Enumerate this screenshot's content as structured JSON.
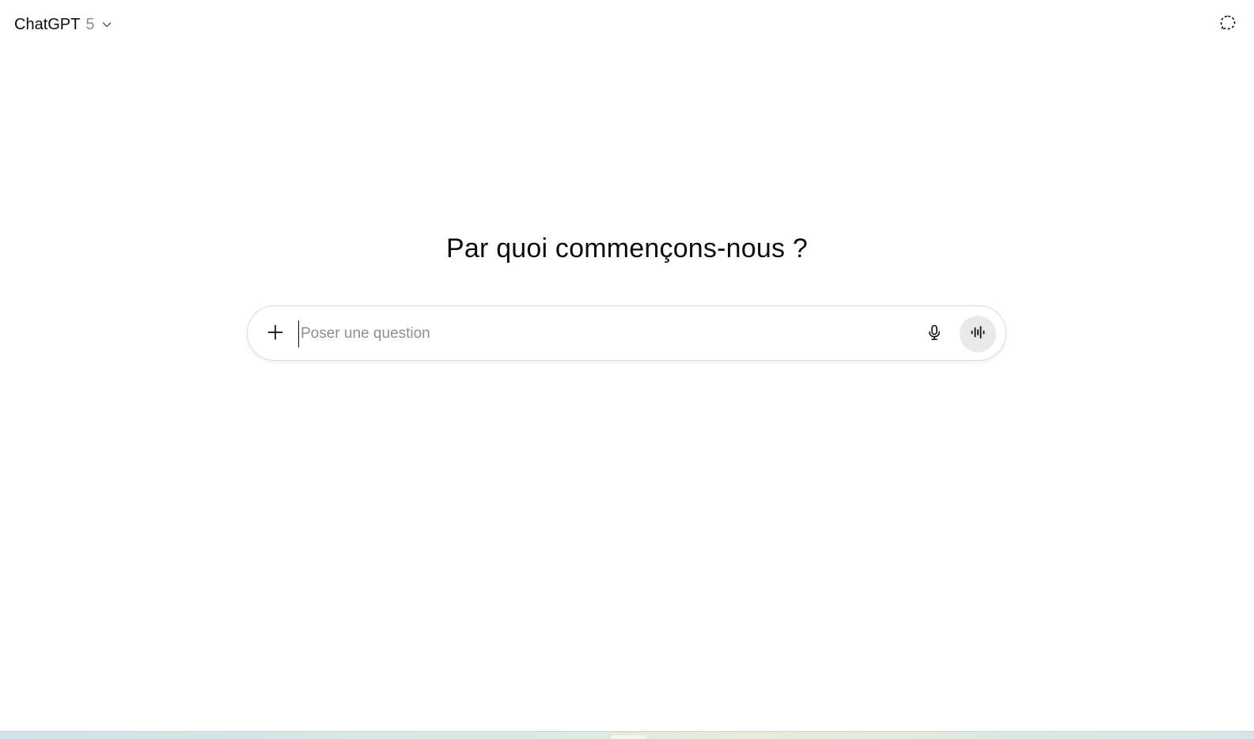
{
  "header": {
    "model_name": "ChatGPT",
    "model_version": "5",
    "model_switcher_icon": "chevron-down-icon",
    "temporary_chat_icon": "dashed-chat-bubble-icon"
  },
  "main": {
    "headline": "Par quoi commençons-nous ?",
    "composer": {
      "placeholder": "Poser une question",
      "value": "",
      "add_icon": "plus-icon",
      "mic_icon": "microphone-icon",
      "voice_icon": "voice-waveform-icon"
    }
  },
  "colors": {
    "text": "#0d0d0d",
    "muted": "#8f8f8f",
    "composer_border": "#dcdcdc",
    "voice_button_bg": "#e9e9e9"
  }
}
